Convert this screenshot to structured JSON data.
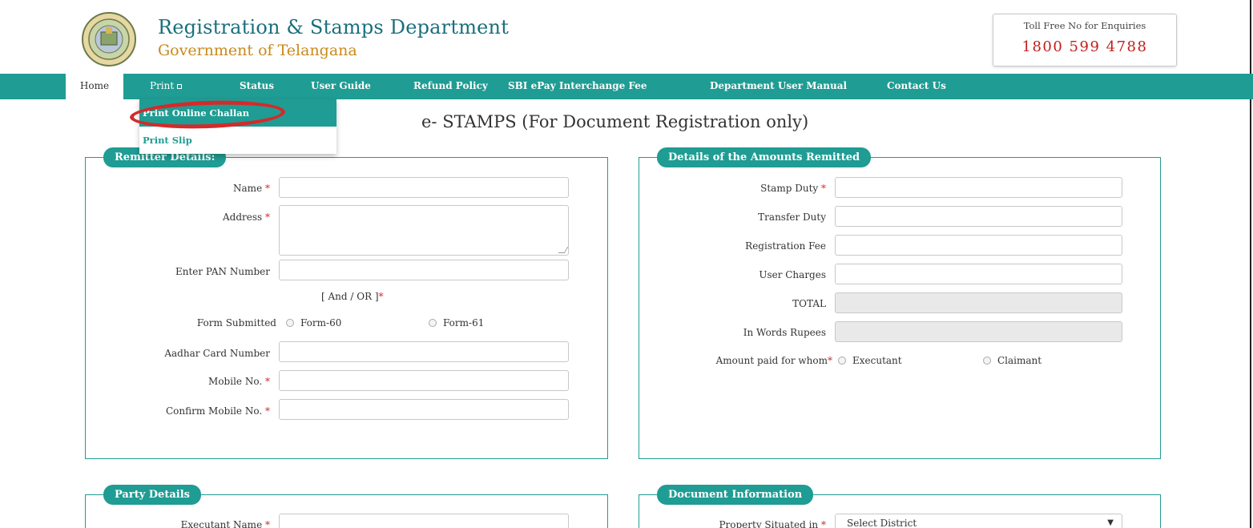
{
  "header": {
    "title": "Registration & Stamps Department",
    "subtitle": "Government of Telangana",
    "toll_label": "Toll Free No for Enquiries",
    "toll_number": "1800 599 4788"
  },
  "nav": {
    "items": [
      "Home",
      "Print",
      "Status",
      "User Guide",
      "Refund Policy",
      "SBI ePay Interchange Fee",
      "Department User Manual",
      "Contact Us"
    ]
  },
  "print_menu": {
    "items": [
      "Print Online Challan",
      "Print Slip"
    ]
  },
  "page_heading": "e- STAMPS (For Document Registration only)",
  "remitter": {
    "legend": "Remitter Details:",
    "name_label": "Name",
    "address_label": "Address",
    "pan_label": "Enter PAN Number",
    "and_or": "[ And / OR ]",
    "form_submitted_label": "Form Submitted",
    "form60": "Form-60",
    "form61": "Form-61",
    "aadhar_label": "Aadhar Card Number",
    "mobile_label": "Mobile No.",
    "confirm_mobile_label": "Confirm Mobile No.",
    "required_mark": "*"
  },
  "amounts": {
    "legend": "Details of the Amounts Remitted",
    "stamp_duty_label": "Stamp Duty",
    "transfer_duty_label": "Transfer Duty",
    "registration_fee_label": "Registration Fee",
    "user_charges_label": "User Charges",
    "total_label": "TOTAL",
    "in_words_label": "In Words Rupees",
    "paid_for_label": "Amount paid for whom",
    "executant": "Executant",
    "claimant": "Claimant"
  },
  "party": {
    "legend": "Party Details",
    "executant_name_label": "Executant Name"
  },
  "document": {
    "legend": "Document Information",
    "property_label": "Property Situated in",
    "district_select": "Select District"
  },
  "colors": {
    "accent": "#1f9c93",
    "title": "#1a6f7c",
    "subtitle": "#c98a1b",
    "required": "#d42a2a",
    "highlight_ring": "#d42a2a"
  }
}
